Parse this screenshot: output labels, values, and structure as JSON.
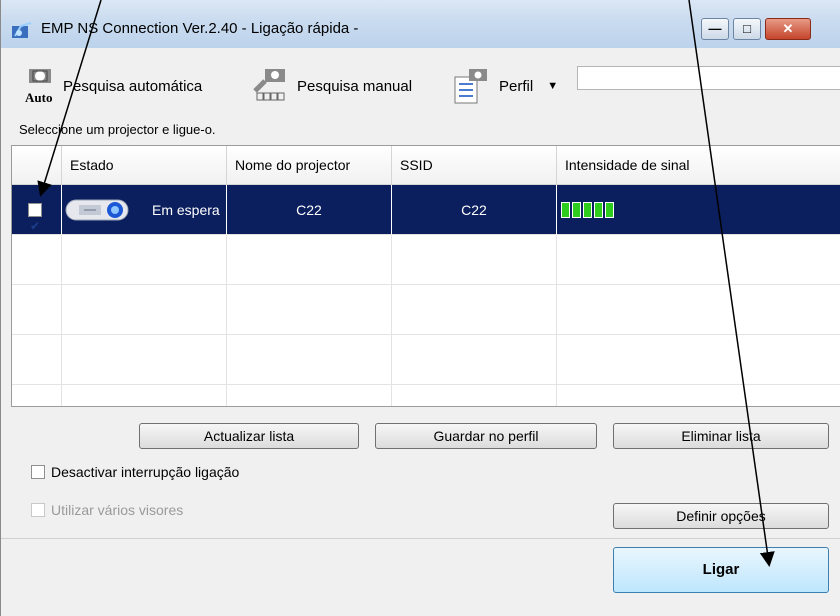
{
  "window": {
    "title": "EMP NS Connection Ver.2.40 - Ligação rápida -",
    "controls": {
      "minimize": "—",
      "maximize": "□",
      "close": "✕"
    }
  },
  "toolbar": {
    "auto_search": {
      "label": "Pesquisa automática",
      "icon_text": "Auto",
      "icon": "auto-search-icon"
    },
    "manual_search": {
      "label": "Pesquisa manual",
      "icon": "manual-search-icon"
    },
    "profile": {
      "label": "Perfil",
      "icon": "profile-icon"
    },
    "profile_selector_value": ""
  },
  "instruction": "Seleccione um projector e ligue-o.",
  "table": {
    "columns": [
      "Estado",
      "Nome do projector",
      "SSID",
      "Intensidade de sinal"
    ],
    "rows": [
      {
        "checked": true,
        "status": "Em espera",
        "projector_name": "C22",
        "ssid": "C22",
        "signal_bars": 5
      }
    ],
    "empty_rows": 4
  },
  "buttons": {
    "update_list": "Actualizar lista",
    "save_profile": "Guardar no perfil",
    "delete_list": "Eliminar lista",
    "set_options": "Definir opções",
    "connect": "Ligar"
  },
  "options": {
    "disable_interrupt": {
      "label": "Desactivar interrupção ligação",
      "checked": false,
      "enabled": true
    },
    "multi_display": {
      "label": "Utilizar vários visores",
      "checked": false,
      "enabled": false
    }
  },
  "colors": {
    "selected_row": "#0b1f5e",
    "signal_bar": "#2ecc1c",
    "connect_button": "#bee6fd"
  }
}
